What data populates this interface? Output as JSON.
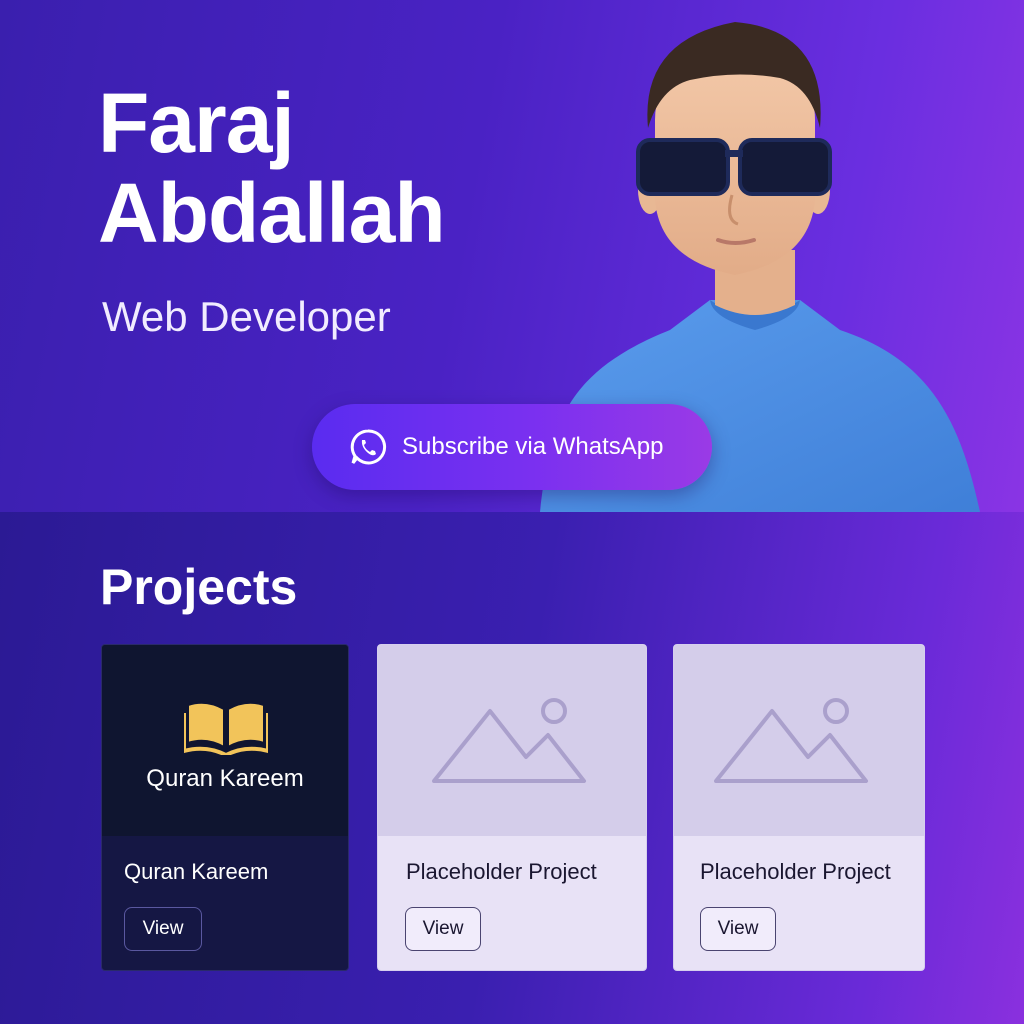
{
  "hero": {
    "name_line1": "Faraj",
    "name_line2": "Abdallah",
    "role": "Web Developer",
    "cta_label": "Subscribe via WhatsApp",
    "cta_icon": "whatsapp-icon"
  },
  "projects": {
    "title": "Projects",
    "items": [
      {
        "thumb_label": "Quran Kareem",
        "thumb_icon": "open-book-icon",
        "title": "Quran Kareem",
        "button": "View"
      },
      {
        "thumb_icon": "image-placeholder-icon",
        "title": "Placeholder Project",
        "button": "View"
      },
      {
        "thumb_icon": "image-placeholder-icon",
        "title": "Placeholder Project",
        "button": "View"
      }
    ]
  },
  "colors": {
    "accent": "#6a2ee0",
    "sweater": "#4a8fe0",
    "book_gold": "#f2c45a"
  }
}
